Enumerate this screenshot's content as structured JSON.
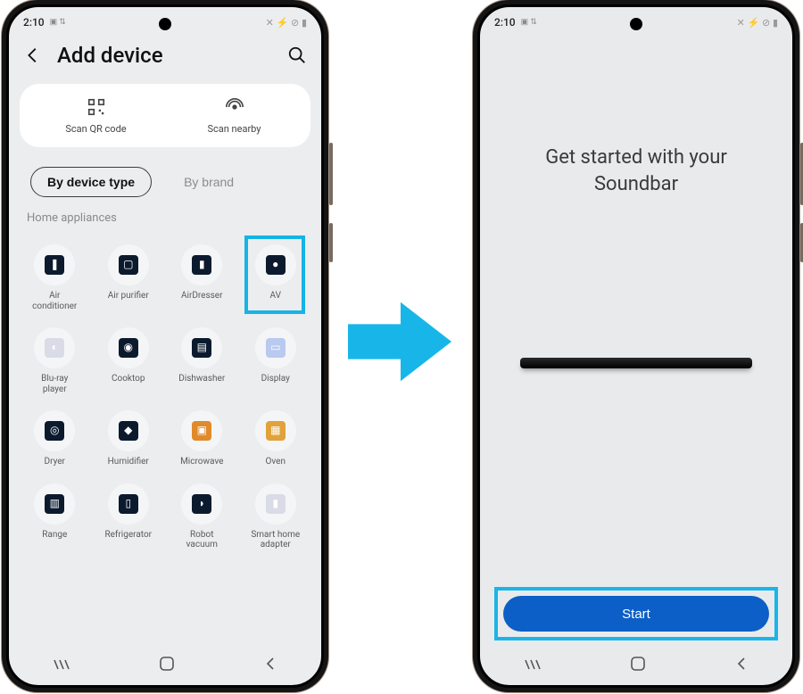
{
  "status": {
    "time": "2:10",
    "icons": "✕ ⚡ ⊘ ▮",
    "small": "▣ ⇅"
  },
  "left": {
    "title": "Add device",
    "scan": {
      "qr": "Scan QR code",
      "nearby": "Scan nearby"
    },
    "filters": {
      "type": "By device type",
      "brand": "By brand"
    },
    "section": "Home appliances",
    "devices": [
      {
        "label": "Air\nconditioner",
        "glyph": "❚",
        "bg": "#0c1a2e",
        "hl": false
      },
      {
        "label": "Air purifier",
        "glyph": "▢",
        "bg": "#0c1a2e",
        "hl": false
      },
      {
        "label": "AirDresser",
        "glyph": "▮",
        "bg": "#0c1a2e",
        "hl": false
      },
      {
        "label": "AV",
        "glyph": "●",
        "bg": "#0c1a2e",
        "hl": true
      },
      {
        "label": "Blu-ray\nplayer",
        "glyph": "◐",
        "bg": "#d9dce6",
        "hl": false
      },
      {
        "label": "Cooktop",
        "glyph": "◉",
        "bg": "#0c1a2e",
        "hl": false
      },
      {
        "label": "Dishwasher",
        "glyph": "▤",
        "bg": "#0c1a2e",
        "hl": false
      },
      {
        "label": "Display",
        "glyph": "▭",
        "bg": "#b9c9ef",
        "hl": false
      },
      {
        "label": "Dryer",
        "glyph": "◎",
        "bg": "#0c1a2e",
        "hl": false
      },
      {
        "label": "Humidifier",
        "glyph": "◆",
        "bg": "#0c1a2e",
        "hl": false
      },
      {
        "label": "Microwave",
        "glyph": "▣",
        "bg": "#e08a2a",
        "hl": false
      },
      {
        "label": "Oven",
        "glyph": "▦",
        "bg": "#e0a23a",
        "hl": false
      },
      {
        "label": "Range",
        "glyph": "▥",
        "bg": "#0c1a2e",
        "hl": false
      },
      {
        "label": "Refrigerator",
        "glyph": "▯",
        "bg": "#0c1a2e",
        "hl": false
      },
      {
        "label": "Robot\nvacuum",
        "glyph": "◗",
        "bg": "#0c1a2e",
        "hl": false
      },
      {
        "label": "Smart home\nadapter",
        "glyph": "▮",
        "bg": "#d9dce6",
        "hl": false
      }
    ]
  },
  "right": {
    "heading_l1": "Get started with your",
    "heading_l2": "Soundbar",
    "start": "Start"
  },
  "highlight_color": "#18b6e8"
}
